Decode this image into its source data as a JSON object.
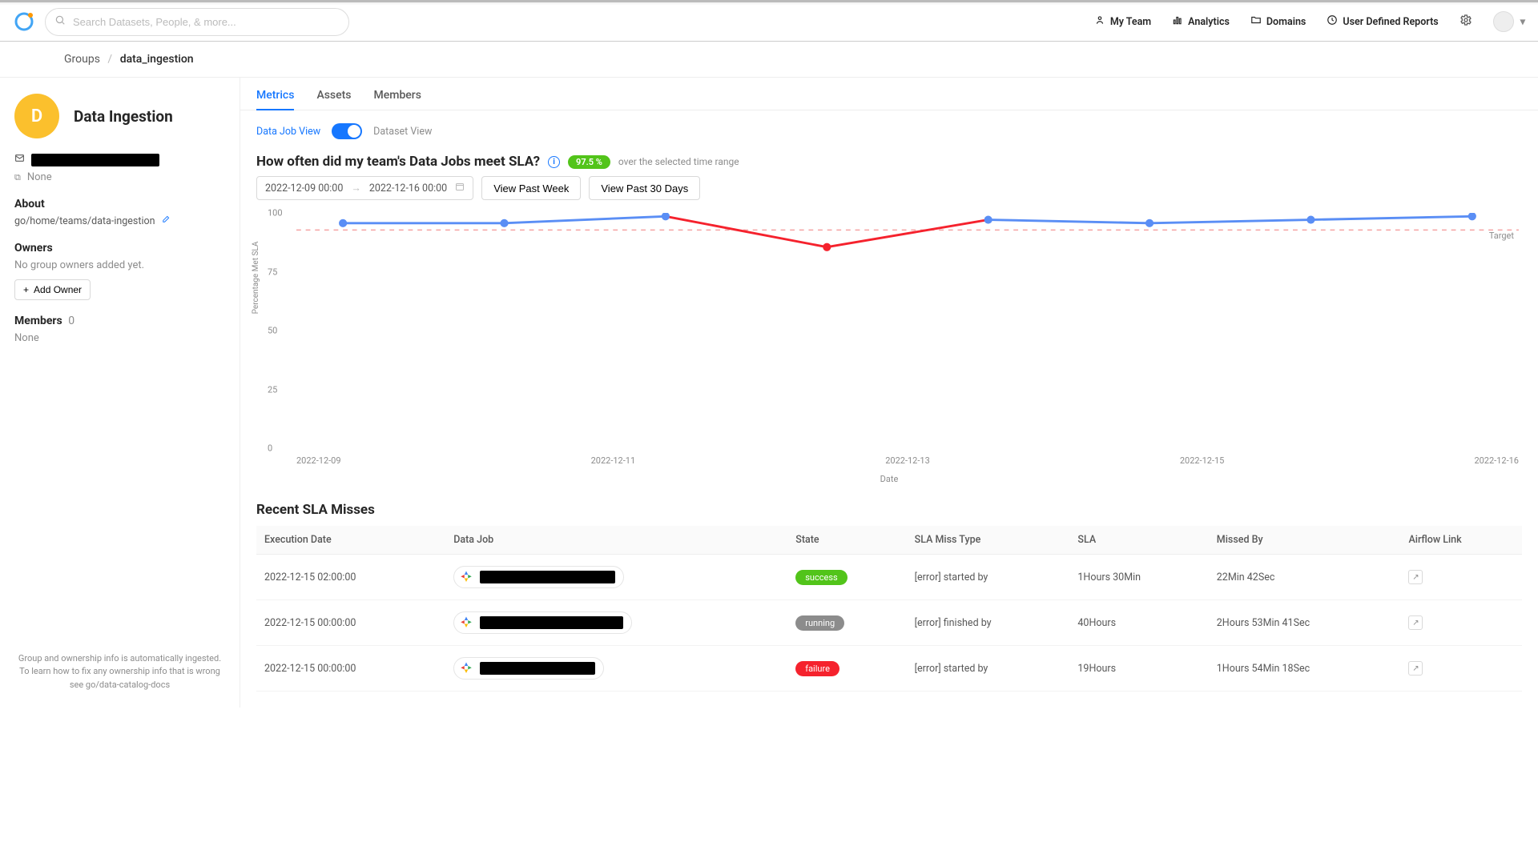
{
  "topnav": {
    "search_placeholder": "Search Datasets, People, & more...",
    "items": [
      {
        "label": "My Team"
      },
      {
        "label": "Analytics"
      },
      {
        "label": "Domains"
      },
      {
        "label": "User Defined Reports"
      }
    ]
  },
  "breadcrumb": {
    "root": "Groups",
    "current": "data_ingestion"
  },
  "group": {
    "avatar_letter": "D",
    "title": "Data Ingestion",
    "contact_none": "None",
    "about_label": "About",
    "about_link": "go/home/teams/data-ingestion",
    "owners_label": "Owners",
    "owners_empty": "No group owners added yet.",
    "add_owner_label": "Add Owner",
    "members_label": "Members",
    "members_count": "0",
    "members_none": "None",
    "footer_note": "Group and ownership info is automatically ingested. To learn how to fix any ownership info that is wrong see go/data-catalog-docs"
  },
  "tabs": [
    {
      "label": "Metrics",
      "active": true
    },
    {
      "label": "Assets",
      "active": false
    },
    {
      "label": "Members",
      "active": false
    }
  ],
  "view_toggle": {
    "left": "Data Job View",
    "right": "Dataset View"
  },
  "question": {
    "title": "How often did my team's Data Jobs meet SLA?",
    "badge": "97.5 %",
    "sub": "over the selected time range"
  },
  "controls": {
    "date_from": "2022-12-09 00:00",
    "date_to": "2022-12-16 00:00",
    "past_week": "View Past Week",
    "past_30": "View Past 30 Days"
  },
  "chart_data": {
    "type": "line",
    "title": "",
    "xlabel": "Date",
    "ylabel": "Percentage Met SLA",
    "ylim": [
      0,
      100
    ],
    "target": 95,
    "target_label": "Target",
    "xtick_labels": [
      "2022-12-09",
      "2022-12-11",
      "2022-12-13",
      "2022-12-15",
      "2022-12-16"
    ],
    "x": [
      "2022-12-09",
      "2022-12-10",
      "2022-12-11",
      "2022-12-12",
      "2022-12-13",
      "2022-12-14",
      "2022-12-15",
      "2022-12-16"
    ],
    "values": [
      97,
      97,
      99,
      90,
      98,
      97,
      98,
      99
    ],
    "yticks": [
      0,
      25,
      50,
      75,
      100
    ]
  },
  "sla_table": {
    "heading": "Recent SLA Misses",
    "columns": [
      "Execution Date",
      "Data Job",
      "State",
      "SLA Miss Type",
      "SLA",
      "Missed By",
      "Airflow Link"
    ],
    "rows": [
      {
        "date": "2022-12-15 02:00:00",
        "state": "success",
        "state_class": "state-success",
        "miss_type": "[error] started by",
        "sla": "1Hours 30Min",
        "missed": "22Min 42Sec"
      },
      {
        "date": "2022-12-15 00:00:00",
        "state": "running",
        "state_class": "state-running",
        "miss_type": "[error] finished by",
        "sla": "40Hours",
        "missed": "2Hours 53Min 41Sec"
      },
      {
        "date": "2022-12-15 00:00:00",
        "state": "failure",
        "state_class": "state-failure",
        "miss_type": "[error] started by",
        "sla": "19Hours",
        "missed": "1Hours 54Min 18Sec"
      }
    ]
  }
}
